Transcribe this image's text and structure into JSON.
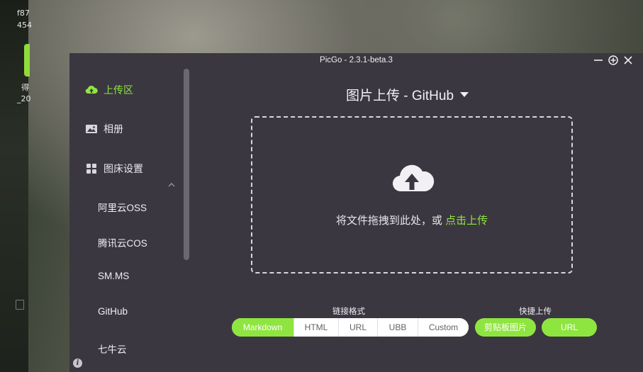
{
  "desktop": {
    "text_lines": [
      "f87",
      "454",
      "得",
      "_20"
    ]
  },
  "window": {
    "title": "PicGo - 2.3.1-beta.3",
    "controls": [
      "minimize-icon",
      "pin-icon",
      "close-icon"
    ]
  },
  "sidebar": {
    "items": [
      {
        "label": "上传区",
        "icon": "upload-cloud-icon",
        "active": true
      },
      {
        "label": "相册",
        "icon": "picture-icon",
        "active": false
      },
      {
        "label": "图床设置",
        "icon": "grid-icon",
        "active": false
      }
    ],
    "sub_items": [
      "阿里云OSS",
      "腾讯云COS",
      "SM.MS",
      "GitHub",
      "七牛云"
    ]
  },
  "main": {
    "title": "图片上传 - GitHub",
    "drop_text": "将文件拖拽到此处，或 ",
    "drop_link": "点击上传"
  },
  "link_format": {
    "label": "链接格式",
    "options": [
      "Markdown",
      "HTML",
      "URL",
      "UBB",
      "Custom"
    ],
    "selected": "Markdown"
  },
  "quick_upload": {
    "label": "快捷上传",
    "clipboard_label": "剪贴板图片",
    "url_label": "URL"
  },
  "colors": {
    "accent": "#8fe540",
    "window_bg": "#3b3740"
  }
}
